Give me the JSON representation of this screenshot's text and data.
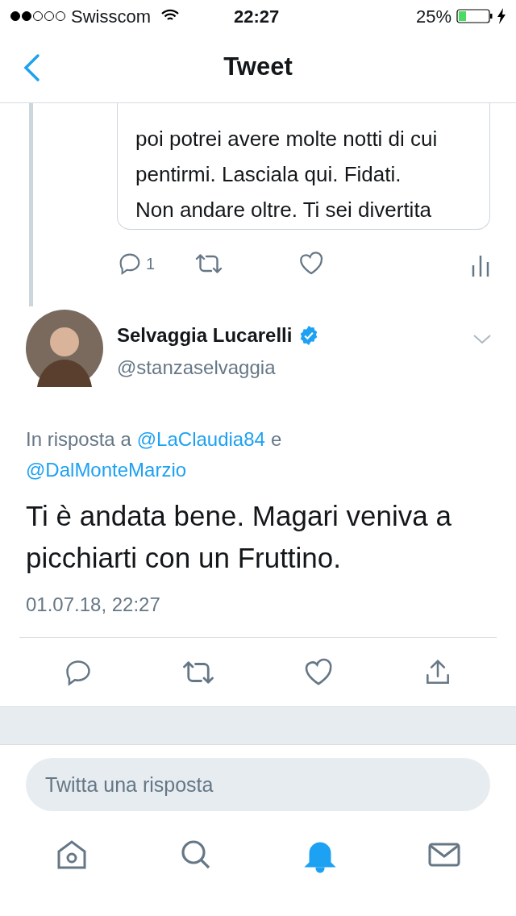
{
  "status_bar": {
    "carrier": "Swisscom",
    "time": "22:27",
    "battery": "25%"
  },
  "nav": {
    "title": "Tweet"
  },
  "quoted_tweet": {
    "lines": [
      "poi potrei avere molte notti di cui",
      "pentirmi. Lasciala qui. Fidati.",
      "Non andare oltre. Ti sei divertita"
    ],
    "reply_count": "1"
  },
  "tweet": {
    "name": "Selvaggia Lucarelli",
    "verified": true,
    "handle": "@stanzaselvaggia",
    "reply_prefix": "In risposta a",
    "mentions": [
      "@LaClaudia84",
      "@DalMonteMarzio"
    ],
    "conjunction": "e",
    "text": "Ti è andata bene. Magari veniva a picchiarti con un Fruttino.",
    "timestamp": "01.07.18, 22:27"
  },
  "reply_field": {
    "placeholder": "Twitta una risposta"
  },
  "tab_bar": [
    {
      "kind": "home",
      "selected": false
    },
    {
      "kind": "search",
      "selected": false
    },
    {
      "kind": "notifications",
      "selected": true
    },
    {
      "kind": "messages",
      "selected": false
    }
  ]
}
